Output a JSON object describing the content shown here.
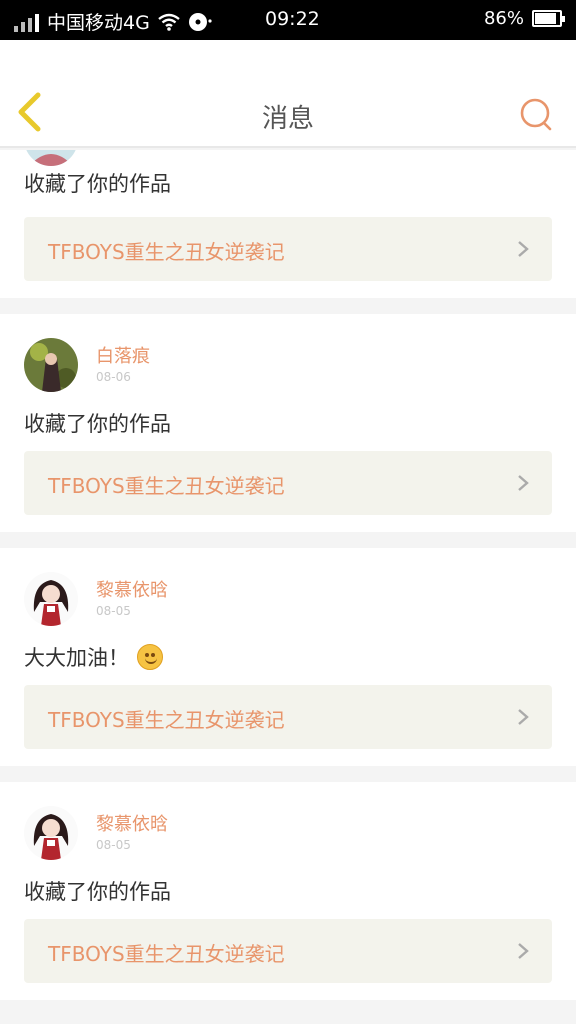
{
  "status": {
    "carrier": "中国移动4G",
    "time": "09:22",
    "battery_text": "86%",
    "battery_level": 0.86
  },
  "nav": {
    "title": "消息"
  },
  "colors": {
    "accent": "#e8956b",
    "back_arrow": "#e8c92c"
  },
  "items": [
    {
      "message": "收藏了你的作品",
      "work_title": "TFBOYS重生之丑女逆袭记"
    },
    {
      "name": "白落痕",
      "date": "08-06",
      "message": "收藏了你的作品",
      "work_title": "TFBOYS重生之丑女逆袭记"
    },
    {
      "name": "黎慕依晗",
      "date": "08-05",
      "message": "大大加油！",
      "emoji": "smile-emoji-icon",
      "work_title": "TFBOYS重生之丑女逆袭记"
    },
    {
      "name": "黎慕依晗",
      "date": "08-05",
      "message": "收藏了你的作品",
      "work_title": "TFBOYS重生之丑女逆袭记"
    }
  ]
}
